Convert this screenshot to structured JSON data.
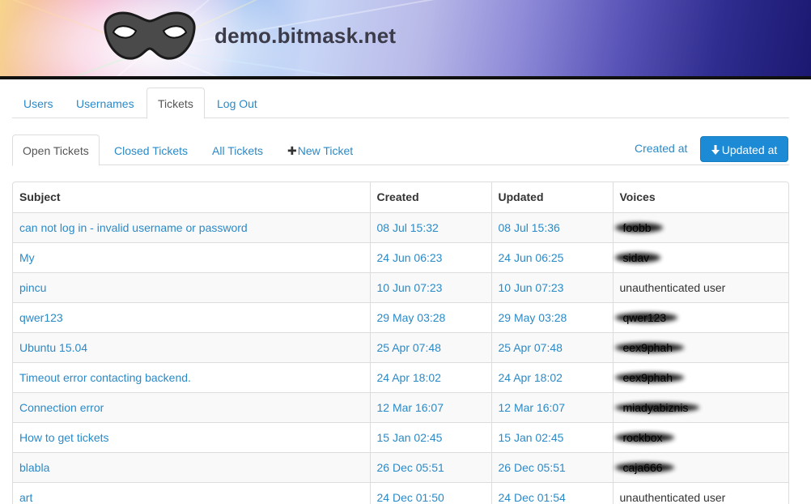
{
  "header": {
    "site_title": "demo.bitmask.net",
    "logo": "mask-logo-icon"
  },
  "top_nav": {
    "tabs": [
      {
        "label": "Users",
        "active": false
      },
      {
        "label": "Usernames",
        "active": false
      },
      {
        "label": "Tickets",
        "active": true
      },
      {
        "label": "Log Out",
        "active": false
      }
    ]
  },
  "sub_nav": {
    "tabs": [
      {
        "label": "Open Tickets",
        "active": true
      },
      {
        "label": "Closed Tickets",
        "active": false
      },
      {
        "label": "All Tickets",
        "active": false
      },
      {
        "label": "New Ticket",
        "active": false,
        "icon": "plus-icon"
      }
    ],
    "sort_created_label": "Created at",
    "sort_updated_label": "Updated at",
    "sort_updated_icon": "arrow-down-icon",
    "accent_color": "#1c8ad4"
  },
  "table": {
    "headers": [
      "Subject",
      "Created",
      "Updated",
      "Voices"
    ],
    "rows": [
      {
        "subject": "can not log in - invalid username or password",
        "created": "08 Jul 15:32",
        "updated": "08 Jul 15:36",
        "voices": "foobb",
        "redacted": true
      },
      {
        "subject": "My",
        "created": "24 Jun 06:23",
        "updated": "24 Jun 06:25",
        "voices": "sidav",
        "redacted": true
      },
      {
        "subject": "pincu",
        "created": "10 Jun 07:23",
        "updated": "10 Jun 07:23",
        "voices": "unauthenticated user",
        "redacted": false
      },
      {
        "subject": "qwer123",
        "created": "29 May 03:28",
        "updated": "29 May 03:28",
        "voices": "qwer123",
        "redacted": true
      },
      {
        "subject": "Ubuntu 15.04",
        "created": "25 Apr 07:48",
        "updated": "25 Apr 07:48",
        "voices": "eex9phah",
        "redacted": true
      },
      {
        "subject": "Timeout error contacting backend.",
        "created": "24 Apr 18:02",
        "updated": "24 Apr 18:02",
        "voices": "eex9phah",
        "redacted": true
      },
      {
        "subject": "Connection error",
        "created": "12 Mar 16:07",
        "updated": "12 Mar 16:07",
        "voices": "miadyabiznis",
        "redacted": true
      },
      {
        "subject": "How to get tickets",
        "created": "15 Jan 02:45",
        "updated": "15 Jan 02:45",
        "voices": "rockbox",
        "redacted": true
      },
      {
        "subject": "blabla",
        "created": "26 Dec 05:51",
        "updated": "26 Dec 05:51",
        "voices": "caja666",
        "redacted": true
      },
      {
        "subject": "art",
        "created": "24 Dec 01:50",
        "updated": "24 Dec 01:54",
        "voices": "unauthenticated user",
        "redacted": false
      }
    ]
  }
}
